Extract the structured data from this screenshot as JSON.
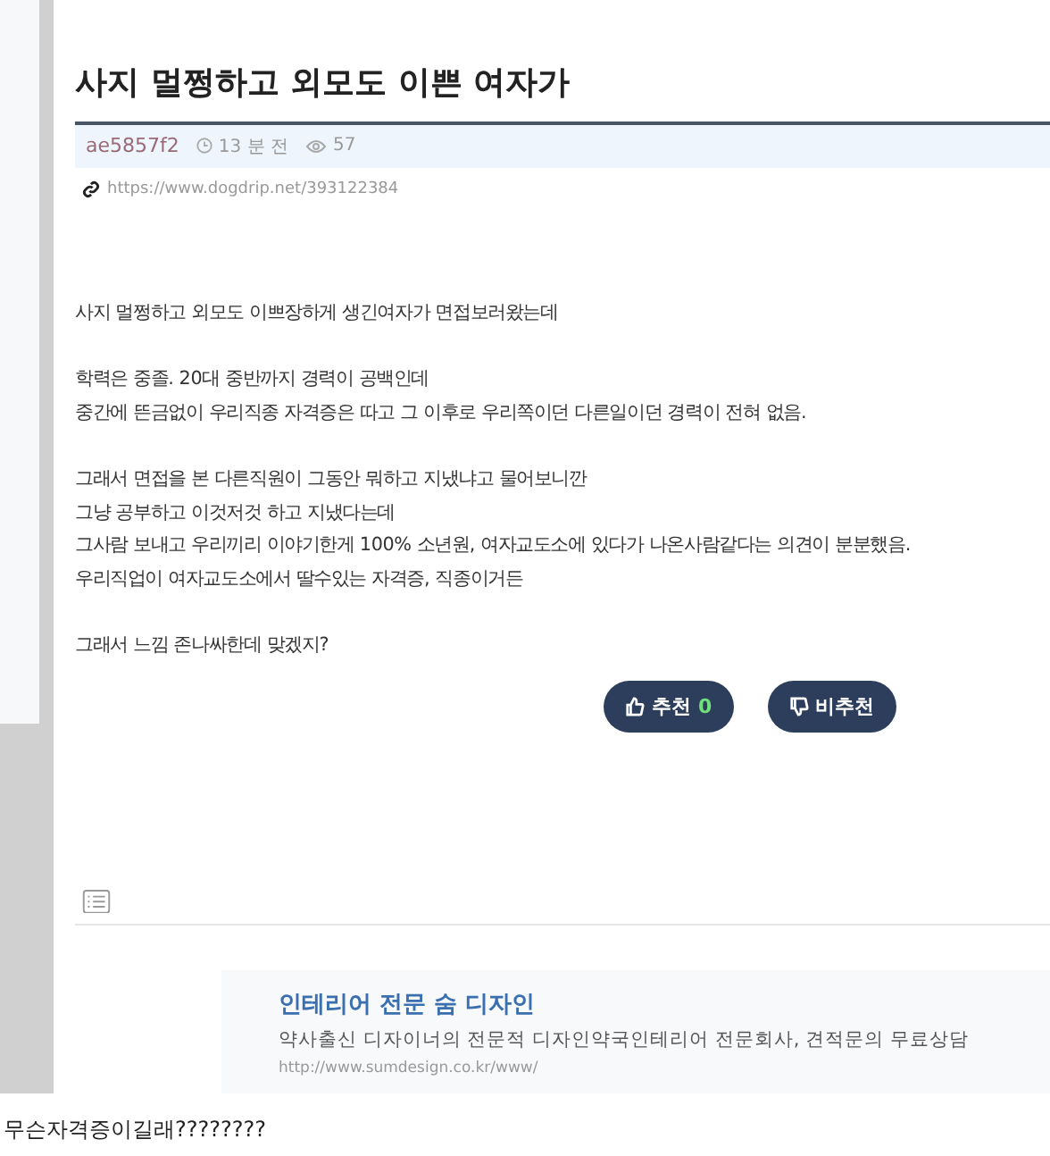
{
  "post": {
    "title": "사지 멀쩡하고 외모도 이쁜 여자가",
    "meta": {
      "author": "ae5857f2",
      "time": "13 분 전",
      "views": "57"
    },
    "link": "https://www.dogdrip.net/393122384",
    "paragraphs": [
      [
        "사지 멀쩡하고 외모도 이쁘장하게 생긴여자가 면접보러왔는데"
      ],
      [
        "학력은 중졸. 20대 중반까지 경력이 공백인데",
        "중간에 뜬금없이 우리직종 자격증은 따고 그 이후로 우리쪽이던 다른일이던 경력이 전혀 없음."
      ],
      [
        "그래서 면접을 본 다른직원이 그동안 뭐하고 지냈냐고 물어보니깐",
        "그냥 공부하고 이것저것 하고 지냈다는데",
        "그사람 보내고 우리끼리 이야기한게 100% 소년원, 여자교도소에 있다가 나온사람같다는 의견이 분분했음.",
        "우리직업이 여자교도소에서 딸수있는 자격증, 직종이거든"
      ],
      [
        "그래서 느낌 존나싸한데 맞겠지?"
      ]
    ],
    "votes": [
      {
        "kind": "up",
        "label": "추천",
        "count": "0"
      },
      {
        "kind": "down",
        "label": "비추천"
      }
    ]
  },
  "ad": {
    "title": "인테리어 전문 숨 디자인",
    "description": "약사출신 디자이너의 전문적 디자인약국인테리어 전문회사, 견적문의 무료상담",
    "url": "http://www.sumdesign.co.kr/www/"
  },
  "comment": "무슨자격증이길래????????"
}
